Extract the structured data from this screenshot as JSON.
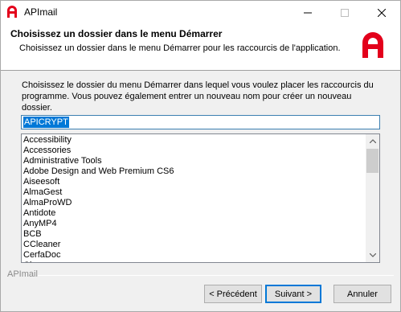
{
  "window": {
    "title": "APImail",
    "controls": {
      "minimize": "—",
      "maximize": "☐",
      "close": "✕"
    }
  },
  "header": {
    "title": "Choisissez un dossier dans le menu Démarrer",
    "subtitle": "Choisissez un dossier dans le menu Démarrer pour les raccourcis de l'application.",
    "logo_icon": "api-logo-icon",
    "accent_color": "#e3001b"
  },
  "content": {
    "description": "Choisissez le dossier du menu Démarrer dans lequel vous voulez placer les raccourcis du programme. Vous pouvez également entrer un nouveau nom pour créer un nouveau dossier.",
    "folder_value": "APICRYPT",
    "folders": [
      "Accessibility",
      "Accessories",
      "Administrative Tools",
      "Adobe Design and Web Premium CS6",
      "Aiseesoft",
      "AlmaGest",
      "AlmaProWD",
      "Antidote",
      "AnyMP4",
      "BCB",
      "CCleaner",
      "CerfaDoc",
      "Cisco"
    ]
  },
  "footer": {
    "brand": "APImail",
    "back_label": "< Précédent",
    "next_label": "Suivant >",
    "cancel_label": "Annuler"
  }
}
